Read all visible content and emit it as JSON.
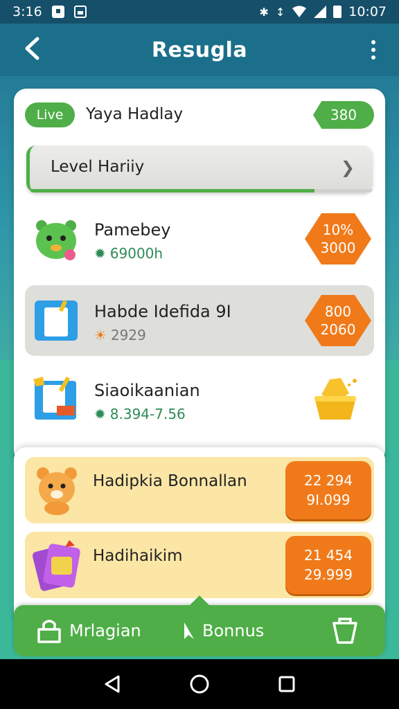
{
  "status_bar": {
    "time": "3:16",
    "clock": "10:07"
  },
  "app_bar": {
    "title": "Resugla"
  },
  "player": {
    "badge": "Live",
    "name": "Yaya Hadlay",
    "score": "380"
  },
  "level": {
    "label": "Level Hariiy",
    "progress_fraction": 0.83
  },
  "rows": [
    {
      "name": "Pamebey",
      "sub": "69000h",
      "badge_line1": "10%",
      "badge_line2": "3000",
      "style": "white",
      "icon": "green-monster-icon"
    },
    {
      "name": "Habde Idefida 9I",
      "sub": "2929",
      "badge_line1": "800",
      "badge_line2": "2060",
      "style": "grey",
      "icon": "milk-glass-icon"
    },
    {
      "name": "Siaoikaanian",
      "sub": "8.394-7.56",
      "style": "white",
      "icon": "drink-cup-icon",
      "reward_icon": "gold-pot-icon"
    }
  ],
  "bonus_rows": [
    {
      "name": "Hadipkia Bonnallan",
      "value_line1": "22 294",
      "value_line2": "9I.099",
      "icon": "bear-icon"
    },
    {
      "name": "Hadihaikim",
      "value_line1": "21 454",
      "value_line2": "29.999",
      "icon": "cards-icon"
    }
  ],
  "bottom_nav": {
    "shop_label": "Mrlagian",
    "bonus_label": "Bonnus"
  },
  "colors": {
    "accent_green": "#4fae47",
    "accent_orange": "#f07a1a",
    "app_bar": "#1b6f8a"
  }
}
